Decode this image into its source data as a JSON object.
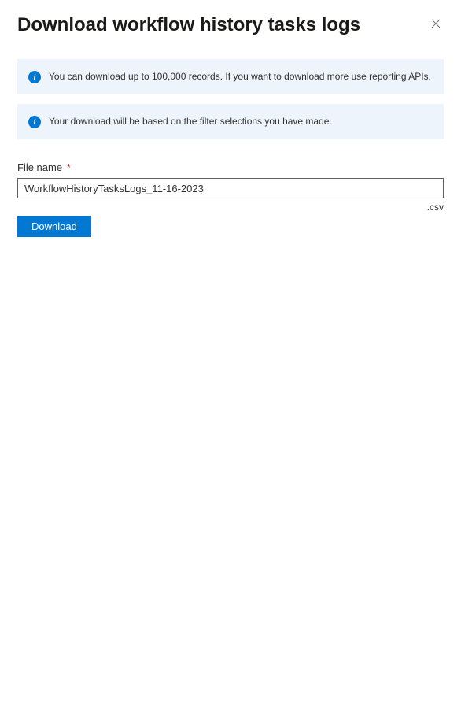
{
  "header": {
    "title": "Download workflow history tasks logs"
  },
  "info_messages": [
    "You can download up to 100,000 records. If you want to download more use reporting APIs.",
    "Your download will be based on the filter selections you have made."
  ],
  "form": {
    "filename_label": "File name",
    "filename_value": "WorkflowHistoryTasksLogs_11-16-2023",
    "extension": ".csv",
    "download_label": "Download"
  }
}
